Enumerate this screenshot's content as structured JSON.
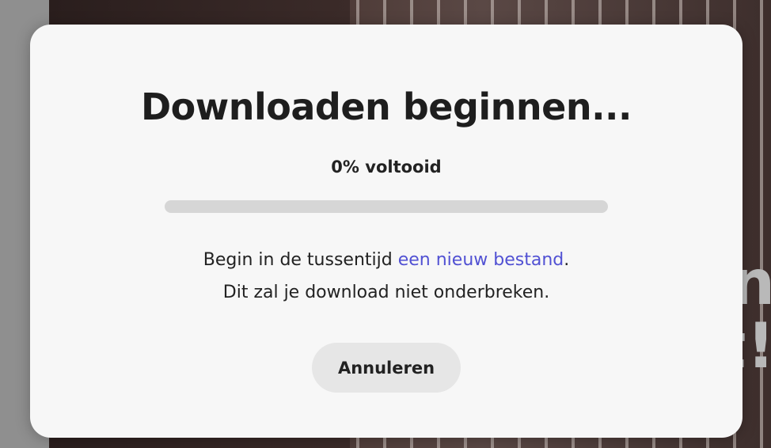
{
  "background": {
    "text_line1": "n",
    "text_line2": "t!"
  },
  "dialog": {
    "title": "Downloaden beginnen...",
    "progress_text": "0% voltooid",
    "progress_fraction": 0,
    "message_line1_prefix": "Begin in de tussentijd ",
    "message_link": "een nieuw bestand",
    "message_line1_suffix": ".",
    "message_line2": "Dit zal je download niet onderbreken.",
    "cancel_label": "Annuleren"
  },
  "colors": {
    "dialog_background": "#f7f7f7",
    "link": "#5151d3",
    "progress_track": "#d6d6d6",
    "button_background": "#e6e6e6",
    "text": "#222222"
  }
}
